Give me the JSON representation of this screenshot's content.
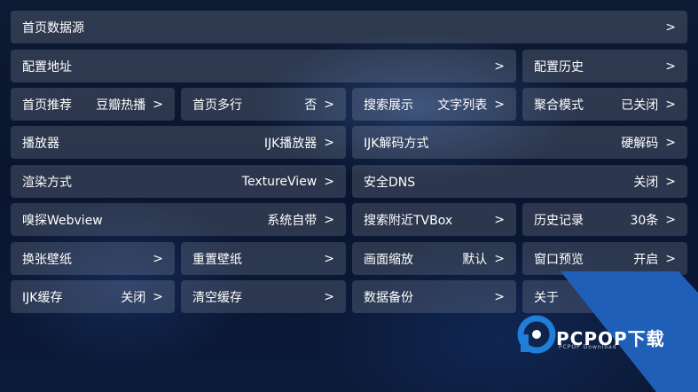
{
  "settings": {
    "home_source": {
      "label": "首页数据源",
      "arrow": ">"
    },
    "config_address": {
      "label": "配置地址",
      "arrow": ">"
    },
    "config_history": {
      "label": "配置历史",
      "arrow": ">"
    },
    "home_recommend": {
      "label": "首页推荐",
      "value": "豆瓣热播",
      "arrow": ">"
    },
    "home_multiline": {
      "label": "首页多行",
      "value": "否",
      "arrow": ">"
    },
    "search_display": {
      "label": "搜索展示",
      "value": "文字列表",
      "arrow": ">"
    },
    "aggregate_mode": {
      "label": "聚合模式",
      "value": "已关闭",
      "arrow": ">"
    },
    "player": {
      "label": "播放器",
      "value": "IJK播放器",
      "arrow": ">"
    },
    "ijk_decode": {
      "label": "IJK解码方式",
      "value": "硬解码",
      "arrow": ">"
    },
    "render_mode": {
      "label": "渲染方式",
      "value": "TextureView",
      "arrow": ">"
    },
    "safe_dns": {
      "label": "安全DNS",
      "value": "关闭",
      "arrow": ">"
    },
    "sniff_webview": {
      "label": "嗅探Webview",
      "value": "系统自带",
      "arrow": ">"
    },
    "search_nearby": {
      "label": "搜索附近TVBox",
      "arrow": ">"
    },
    "history_records": {
      "label": "历史记录",
      "value": "30条",
      "arrow": ">"
    },
    "change_wallpaper": {
      "label": "换张壁纸",
      "arrow": ">"
    },
    "reset_wallpaper": {
      "label": "重置壁纸",
      "arrow": ">"
    },
    "screen_scale": {
      "label": "画面缩放",
      "value": "默认",
      "arrow": ">"
    },
    "window_preview": {
      "label": "窗口预览",
      "value": "开启",
      "arrow": ">"
    },
    "ijk_cache": {
      "label": "IJK缓存",
      "value": "关闭",
      "arrow": ">"
    },
    "clear_cache": {
      "label": "清空缓存",
      "arrow": ">"
    },
    "data_backup": {
      "label": "数据备份",
      "arrow": ">"
    },
    "about": {
      "label": "关于"
    }
  },
  "watermark": {
    "brand": "PCPOP下载",
    "sub": "PCPOP Download",
    "color": "#1f5fb8"
  }
}
